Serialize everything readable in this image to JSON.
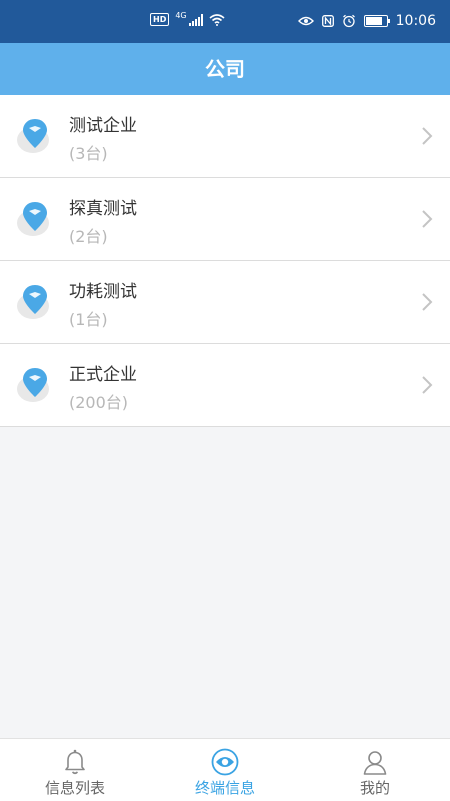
{
  "status_bar": {
    "network_label": "HD",
    "network_type": "4G",
    "time": "10:06"
  },
  "header": {
    "title": "公司"
  },
  "companies": [
    {
      "name": "测试企业",
      "count": "(3台)"
    },
    {
      "name": "探真测试",
      "count": "(2台)"
    },
    {
      "name": "功耗测试",
      "count": "(1台)"
    },
    {
      "name": "正式企业",
      "count": "(200台)"
    }
  ],
  "tabs": [
    {
      "label": "信息列表",
      "icon": "bell-icon",
      "active": false
    },
    {
      "label": "终端信息",
      "icon": "terminal-icon",
      "active": true
    },
    {
      "label": "我的",
      "icon": "person-icon",
      "active": false
    }
  ],
  "colors": {
    "status_bar": "#21599a",
    "header": "#5fb0eb",
    "accent": "#3aa3e3"
  }
}
